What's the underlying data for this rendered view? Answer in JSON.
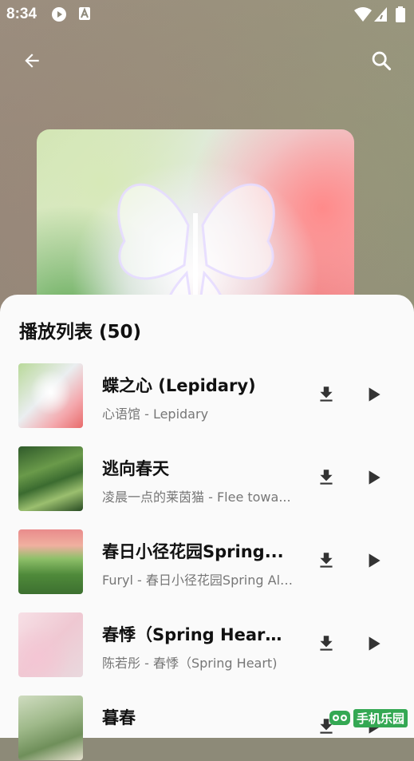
{
  "status_bar": {
    "time": "8:34"
  },
  "playlist": {
    "title": "播放列表 (50)",
    "tracks": [
      {
        "title": "蝶之心 (Lepidary)",
        "subtitle": "心语馆 - Lepidary"
      },
      {
        "title": "逃向春天",
        "subtitle": "凌晨一点的莱茵猫 - Flee towa..."
      },
      {
        "title": "春日小径花园Spring...",
        "subtitle": "Furyl - 春日小径花园Spring All..."
      },
      {
        "title": "春悸（Spring Heart）",
        "subtitle": "陈若彤 - 春悸（Spring Heart)"
      },
      {
        "title": "暮春",
        "subtitle": ""
      }
    ]
  },
  "icons": {
    "back": "arrow-left-icon",
    "search": "search-icon",
    "download": "download-icon",
    "play": "play-icon"
  },
  "watermark": {
    "text": "手机乐园"
  },
  "colors": {
    "accent_bg": "#8e8b7c",
    "sheet_bg": "#fafafa",
    "text_primary": "#111111",
    "text_secondary": "#777777",
    "icon": "#333333"
  }
}
